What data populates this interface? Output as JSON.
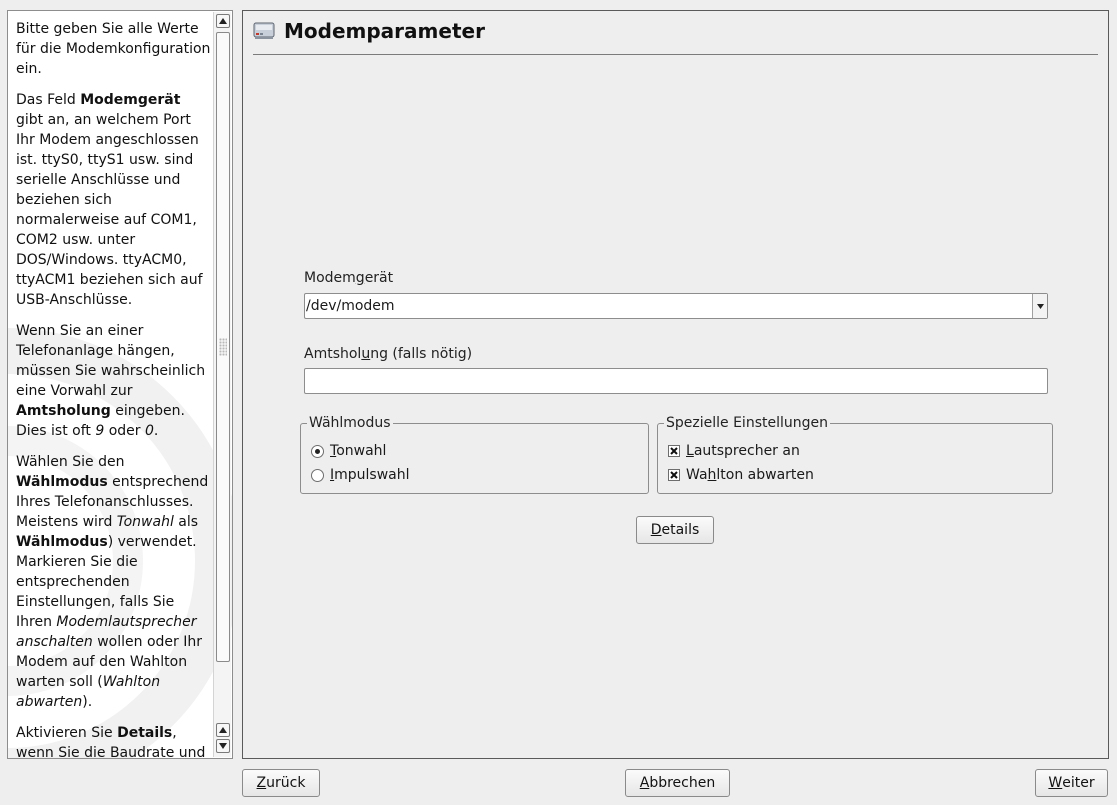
{
  "help": {
    "p1": "Bitte geben Sie alle Werte für die Modemkonfiguration ein.",
    "p2_a": "Das Feld ",
    "p2_b": "Modemgerät",
    "p2_c": " gibt an, an welchem Port Ihr Modem angeschlossen ist. ttyS0, ttyS1 usw. sind serielle Anschlüsse und beziehen sich normalerweise auf COM1, COM2 usw. unter DOS/Windows. ttyACM0, ttyACM1 beziehen sich auf USB-Anschlüsse.",
    "p3_a": "Wenn Sie an einer Telefonanlage hängen, müssen Sie wahrscheinlich eine Vorwahl zur ",
    "p3_b": "Amtsholung",
    "p3_c": " eingeben. Dies ist oft ",
    "p3_d": "9",
    "p3_e": " oder ",
    "p3_f": "0",
    "p3_g": ".",
    "p4_a": "Wählen Sie den ",
    "p4_b": "Wählmodus",
    "p4_c": " entsprechend Ihres Telefonanschlusses. Meistens wird ",
    "p4_d": "Tonwahl",
    "p4_e": " als ",
    "p4_f": "Wählmodus",
    "p4_g": ") verwendet. Markieren Sie die entsprechenden Einstellungen, falls Sie Ihren ",
    "p4_h": "Modemlautsprecher anschalten",
    "p4_i": " wollen oder Ihr Modem auf den Wahlton warten soll (",
    "p4_j": "Wahlton abwarten",
    "p4_k": ").",
    "p5_a": "Aktivieren Sie ",
    "p5_b": "Details",
    "p5_c": ", wenn Sie die Baudrate und"
  },
  "page_title": "Modemparameter",
  "modem_device": {
    "label_pre": "Modem",
    "label_u": "g",
    "label_post": "erät",
    "value": "/dev/modem"
  },
  "prefix": {
    "label_pre": "Amtshol",
    "label_u": "u",
    "label_post": "ng (falls nötig)",
    "value": ""
  },
  "dial_mode": {
    "title": "Wählmodus",
    "options": [
      {
        "u": "T",
        "rest": "onwahl",
        "selected": true
      },
      {
        "u": "I",
        "rest": "mpulswahl",
        "selected": false
      }
    ]
  },
  "special": {
    "title": "Spezielle Einstellungen",
    "options": [
      {
        "pre": "",
        "u": "L",
        "rest": "autsprecher an",
        "checked": true
      },
      {
        "pre": "Wa",
        "u": "h",
        "rest": "lton abwarten",
        "checked": true
      }
    ]
  },
  "details_button": {
    "u": "D",
    "rest": "etails"
  },
  "footer": {
    "back": {
      "u": "Z",
      "rest": "urück"
    },
    "cancel": {
      "u": "A",
      "rest": "bbrechen"
    },
    "next": {
      "u": "W",
      "rest": "eiter"
    }
  }
}
